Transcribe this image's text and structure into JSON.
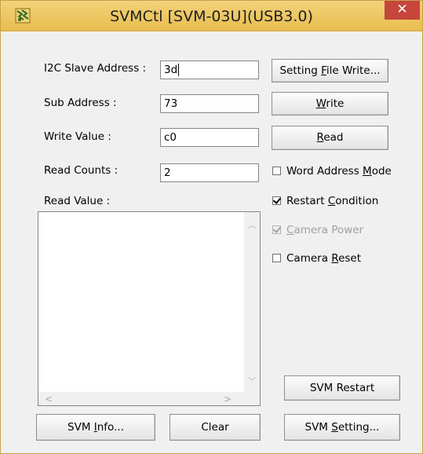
{
  "window": {
    "title": "SVMCtl [SVM-03U](USB3.0)",
    "close_glyph": "✕",
    "accent_color": "#e8bd4f",
    "close_color": "#c7463c"
  },
  "labels": {
    "i2c_slave_address": "I2C Slave Address :",
    "sub_address": "Sub Address :",
    "write_value": "Write Value :",
    "read_counts": "Read Counts :",
    "read_value": "Read Value :"
  },
  "inputs": {
    "i2c_slave_address": "3d",
    "sub_address": "73",
    "write_value": "c0",
    "read_counts": "2"
  },
  "buttons": {
    "setting_file_write_pre": "Setting ",
    "setting_file_write_mn": "F",
    "setting_file_write_post": "ile Write...",
    "write_mn": "W",
    "write_post": "rite",
    "read_mn": "R",
    "read_post": "ead",
    "svm_restart": "SVM Restart",
    "svm_info_pre": "SVM ",
    "svm_info_mn": "I",
    "svm_info_post": "nfo...",
    "clear": "Clear",
    "svm_setting_pre": "SVM ",
    "svm_setting_mn": "S",
    "svm_setting_post": "etting..."
  },
  "checkboxes": {
    "word_address_mode_pre": "Word Address ",
    "word_address_mode_mn": "M",
    "word_address_mode_post": "ode",
    "word_address_mode_checked": false,
    "restart_condition_pre": "Restart ",
    "restart_condition_mn": "C",
    "restart_condition_post": "ondition",
    "restart_condition_checked": true,
    "camera_power_mn": "C",
    "camera_power_post": "amera Power",
    "camera_power_checked": true,
    "camera_power_disabled": true,
    "camera_reset_pre": "Camera ",
    "camera_reset_mn": "R",
    "camera_reset_post": "eset",
    "camera_reset_checked": false
  },
  "read_value_text": ""
}
